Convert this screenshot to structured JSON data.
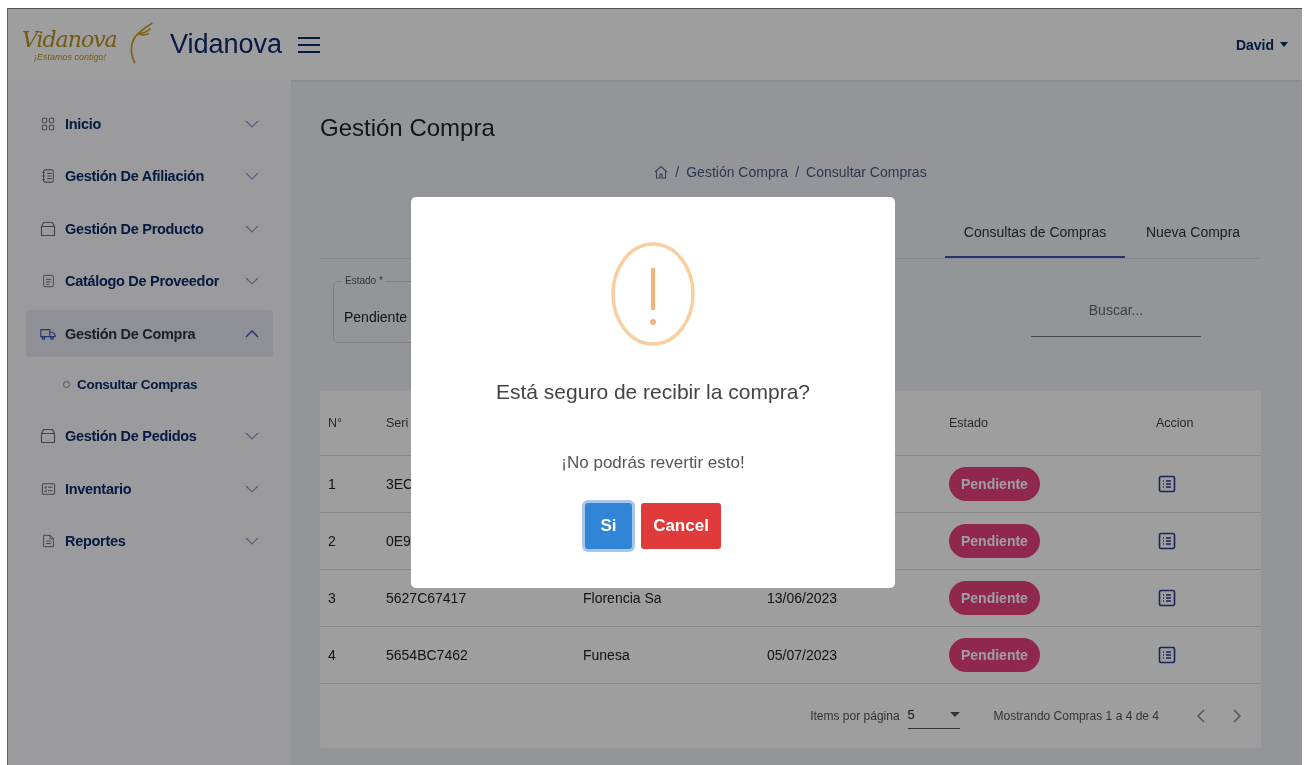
{
  "header": {
    "logo_script": "Vidanova",
    "logo_tagline": "¡Estamos contigo!",
    "brand": "Vidanova",
    "user": "David"
  },
  "sidebar": {
    "items": [
      {
        "label": "Inicio",
        "expanded": false,
        "selected": false
      },
      {
        "label": "Gestión De Afiliación",
        "expanded": false,
        "selected": false
      },
      {
        "label": "Gestión De Producto",
        "expanded": false,
        "selected": false
      },
      {
        "label": "Catálogo De Proveedor",
        "expanded": false,
        "selected": false
      },
      {
        "label": "Gestión De Compra",
        "expanded": true,
        "selected": true,
        "children": [
          {
            "label": "Consultar Compras",
            "selected": true
          }
        ]
      },
      {
        "label": "Gestión De Pedidos",
        "expanded": false,
        "selected": false
      },
      {
        "label": "Inventario",
        "expanded": false,
        "selected": false
      },
      {
        "label": "Reportes",
        "expanded": false,
        "selected": false
      }
    ]
  },
  "page": {
    "title": "Gestión Compra",
    "breadcrumb": [
      {
        "separator": "/",
        "label": "Gestión Compra"
      },
      {
        "separator": "/",
        "label": "Consultar Compras"
      }
    ]
  },
  "tabs": [
    {
      "label": "Consultas de Compras",
      "selected": true
    },
    {
      "label": "Nueva Compra",
      "selected": false
    }
  ],
  "filters": {
    "estado": {
      "label": "Estado *",
      "value": "Pendiente"
    },
    "search": {
      "placeholder": "Buscar..."
    }
  },
  "table": {
    "columns": [
      {
        "label": "N°"
      },
      {
        "label": "Seri"
      },
      {},
      {},
      {
        "label": "Estado"
      },
      {
        "label": "Accion"
      }
    ],
    "rows": [
      {
        "cells": [
          "1",
          "3EC",
          null,
          null
        ],
        "status": "Pendiente"
      },
      {
        "cells": [
          "2",
          "0E9",
          null,
          null
        ],
        "status": "Pendiente"
      },
      {
        "cells": [
          "3",
          "5627C67417",
          "Florencia Sa",
          "13/06/2023"
        ],
        "status": "Pendiente"
      },
      {
        "cells": [
          "4",
          "5654BC7462",
          "Funesa",
          "05/07/2023"
        ],
        "status": "Pendiente"
      }
    ]
  },
  "pagination": {
    "label": "Items por página",
    "page_size": "5",
    "summary": "Mostrando Compras 1 a 4 de 4"
  },
  "dialog": {
    "title": "Está seguro de recibir la compra?",
    "text": "¡No podrás revertir esto!",
    "buttons": [
      {
        "label": "Si",
        "kind": "confirm",
        "focused": true
      },
      {
        "label": "Cancel",
        "kind": "cancel",
        "focused": false
      }
    ]
  }
}
